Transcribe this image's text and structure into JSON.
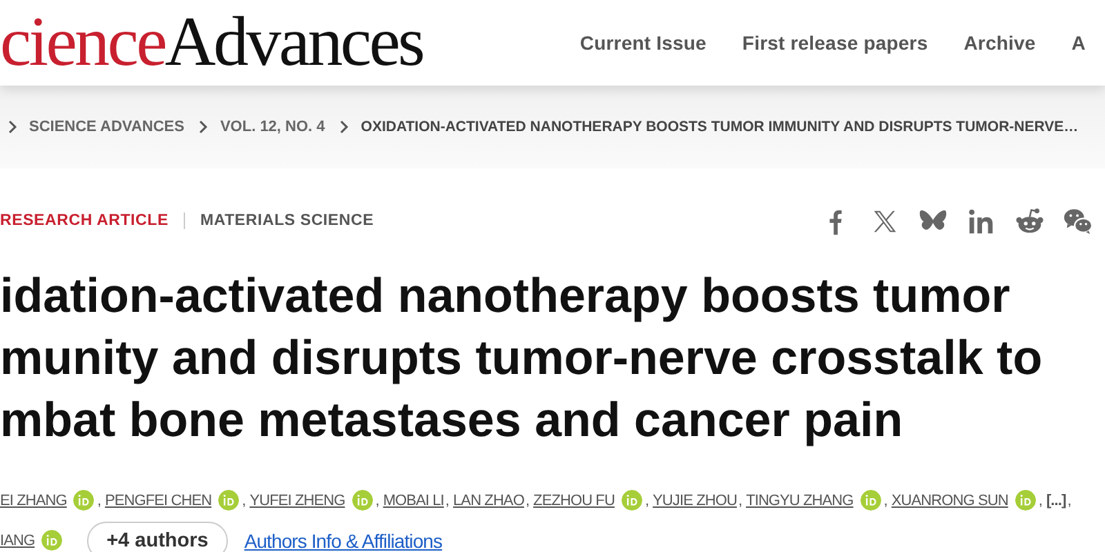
{
  "header": {
    "logo": {
      "red_part": "cience",
      "black_part": "Advances"
    },
    "nav": [
      "Current Issue",
      "First release papers",
      "Archive",
      "A"
    ]
  },
  "breadcrumb": [
    "SCIENCE ADVANCES",
    "VOL. 12, NO. 4",
    "OXIDATION-ACTIVATED NANOTHERAPY BOOSTS TUMOR IMMUNITY AND DISRUPTS TUMOR-NERVE…"
  ],
  "article": {
    "type": "RESEARCH ARTICLE",
    "subject": "MATERIALS SCIENCE",
    "share": [
      {
        "kind": "facebook"
      },
      {
        "kind": "x"
      },
      {
        "kind": "butterfly"
      },
      {
        "kind": "linkedin"
      },
      {
        "kind": "reddit"
      },
      {
        "kind": "wechat"
      }
    ],
    "title_lines": [
      "idation-activated nanotherapy boosts tumor",
      "munity and disrupts tumor-nerve crosstalk to",
      "mbat bone metastases and cancer pain"
    ],
    "author_lines": [
      [
        {
          "name": "EI ZHANG",
          "orcid": true,
          "sep": ","
        },
        {
          "name": "PENGFEI CHEN",
          "orcid": true,
          "sep": ","
        },
        {
          "name": "YUFEI ZHENG",
          "orcid": true,
          "sep": ","
        },
        {
          "name": "MOBAI LI",
          "orcid": false,
          "sep": ","
        },
        {
          "name": "LAN ZHAO",
          "orcid": false,
          "sep": ","
        },
        {
          "name": "ZEZHOU FU",
          "orcid": true,
          "sep": ","
        },
        {
          "name": "YUJIE ZHOU",
          "orcid": false,
          "sep": ","
        },
        {
          "name": "TINGYU ZHANG",
          "orcid": true,
          "sep": ","
        },
        {
          "name": "XUANRONG SUN",
          "orcid": true,
          "sep": ","
        },
        {
          "name": "[...]",
          "kind": "more",
          "orcid": false,
          "sep": ","
        }
      ],
      [
        {
          "name": "IANG",
          "orcid": true
        }
      ]
    ],
    "more_authors": "+4 authors",
    "affiliations_link": "Authors Info & Affiliations"
  }
}
